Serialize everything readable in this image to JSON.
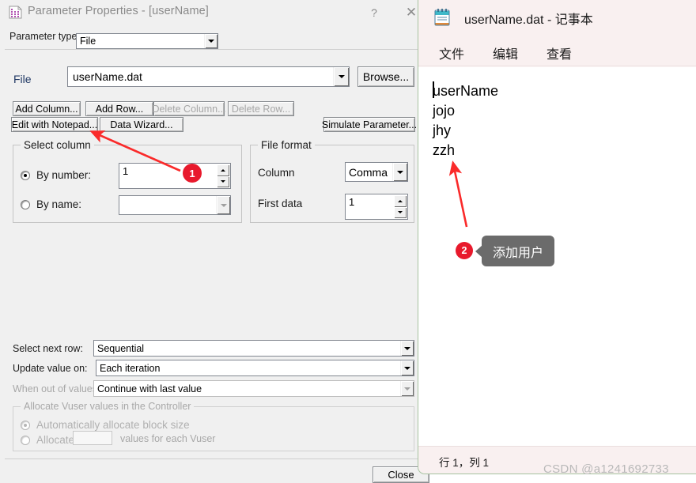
{
  "dialog": {
    "title": "Parameter Properties - [userName]",
    "icon": "parameter-table-icon",
    "help_label": "?",
    "close_label": "✕",
    "parameter_type_label": "Parameter type:",
    "parameter_type_value": "File",
    "file_label": "File",
    "file_value": "userName.dat",
    "browse_label": "Browse...",
    "buttons": {
      "add_column": "Add Column...",
      "add_row": "Add Row...",
      "delete_column": "Delete Column...",
      "delete_row": "Delete Row...",
      "edit_with_notepad": "Edit with Notepad...",
      "data_wizard": "Data Wizard...",
      "simulate_parameter": "Simulate Parameter...",
      "close": "Close"
    },
    "select_column": {
      "title": "Select column",
      "by_number_label": "By number:",
      "by_number_value": "1",
      "by_name_label": "By name:",
      "by_name_value": ""
    },
    "file_format": {
      "title": "File format",
      "column_label": "Column",
      "column_value": "Comma",
      "first_data_label": "First data",
      "first_data_value": "1"
    },
    "lower": {
      "select_next_row_label": "Select next row:",
      "select_next_row_value": "Sequential",
      "update_value_on_label": "Update value on:",
      "update_value_on_value": "Each iteration",
      "when_out_of_values_label": "When out of values:",
      "when_out_of_values_value": "Continue with last value"
    },
    "allocate": {
      "title": "Allocate Vuser values in the Controller",
      "auto_label": "Automatically allocate block size",
      "allocate_label": "Allocate",
      "allocate_value": "",
      "suffix_label": "values for each Vuser"
    }
  },
  "notepad": {
    "icon": "notepad-icon",
    "title": "userName.dat - 记事本",
    "menu": [
      "文件",
      "编辑",
      "查看"
    ],
    "content_lines": [
      "userName",
      "jojo",
      "jhy",
      "zzh"
    ],
    "status": "行 1，列 1"
  },
  "annotations": {
    "badge1": "1",
    "badge2": "2",
    "callout2_text": "添加用户",
    "arrow_color": "#fa2a2a",
    "badge_color": "#e8192c",
    "callout_bg": "#6b6b6b"
  },
  "watermark": "CSDN @a1241692733"
}
